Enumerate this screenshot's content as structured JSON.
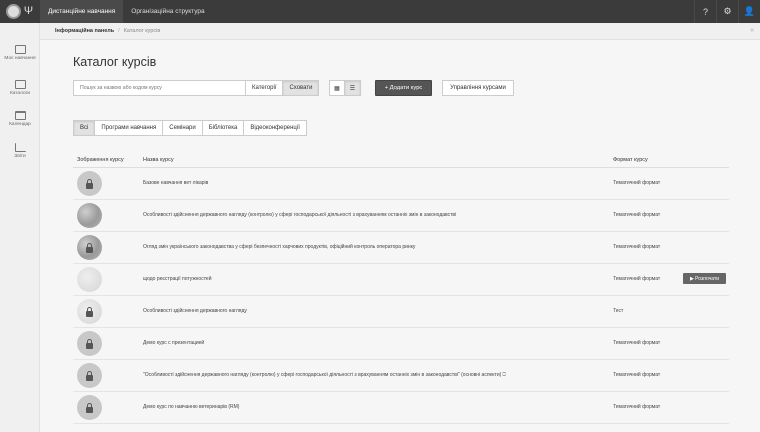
{
  "topbar": {
    "nav": [
      "Дистанційне навчання",
      "Організаційна структура"
    ],
    "icons": [
      "help-icon",
      "gear-icon",
      "user-icon"
    ]
  },
  "breadcrumb": {
    "home": "Інформаційна панель",
    "separator": "/",
    "current": "Каталог курсів"
  },
  "sidebar": {
    "items": [
      {
        "label": "Моє навчання",
        "icon": "play-icon"
      },
      {
        "label": "Каталоги",
        "icon": "catalog-icon"
      },
      {
        "label": "Календар",
        "icon": "calendar-icon"
      },
      {
        "label": "Звіти",
        "icon": "chart-icon"
      }
    ]
  },
  "main": {
    "title": "Каталог курсів",
    "search_placeholder": "Пошук за назвою або кодом курсу",
    "view_toggle": [
      "Категорії",
      "Сховати"
    ],
    "add_course": "+ Додати курс",
    "manage_courses": "Управління курсами",
    "tabs": [
      "Всі",
      "Програми навчання",
      "Семінари",
      "Бібліотека",
      "Відеоконференції"
    ],
    "columns": [
      "Зображення курсу",
      "Назва курсу",
      "Формат курсу"
    ],
    "start_label": "▶ Розпочати",
    "rows": [
      {
        "name": "Базове навчання вет лікарів",
        "format": "Тематичний формат"
      },
      {
        "name": "Особливості здійснення державного нагляду (контролю) у сфері господарської діяльності з врахуванням останніх змін в законодавстві",
        "format": "Тематичний формат"
      },
      {
        "name": "Огляд змін українського законодавства у сфері безпечності харчових продуктів, офіційний контроль оператора ринку",
        "format": "Тематичний формат"
      },
      {
        "name": "щодо реєстрації потужностей",
        "format": "Тематичний формат"
      },
      {
        "name": "Особливості здійснення державного нагляду",
        "format": "Тест"
      },
      {
        "name": "Демо курс с презентацией",
        "format": "Тематичний формат"
      },
      {
        "name": "\"Особливості здійснення державного нагляду (контролю) у сфері господарської діяльності з врахуванням останніх змін в законодавстві\" (основні аспекти) ⎕",
        "format": "Тематичний формат"
      },
      {
        "name": "Демо курс по навчанню ветеринарів (RM)",
        "format": "Тематичний формат"
      }
    ]
  }
}
